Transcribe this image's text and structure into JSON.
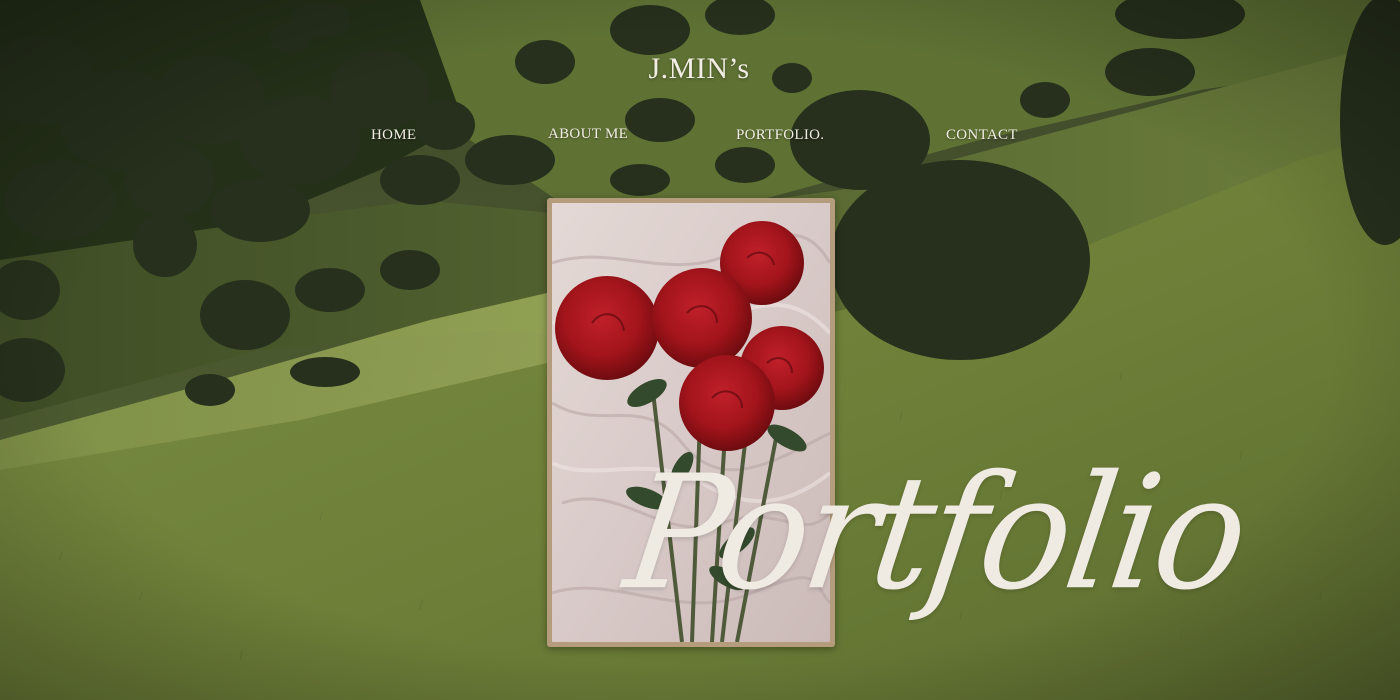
{
  "header": {
    "site_title": "J.MIN’s"
  },
  "nav": {
    "items": [
      {
        "label": "HOME"
      },
      {
        "label": "ABOUT ME"
      },
      {
        "label": "PORTFOLIO."
      },
      {
        "label": "CONTACT"
      }
    ]
  },
  "hero": {
    "script_title": "Portfolio",
    "image_subject": "red roses on white fabric"
  },
  "colors": {
    "text": "#f2ede4",
    "frame": "#b49c7c",
    "grass": "#6e7f3e",
    "rose": "#a8161c"
  }
}
